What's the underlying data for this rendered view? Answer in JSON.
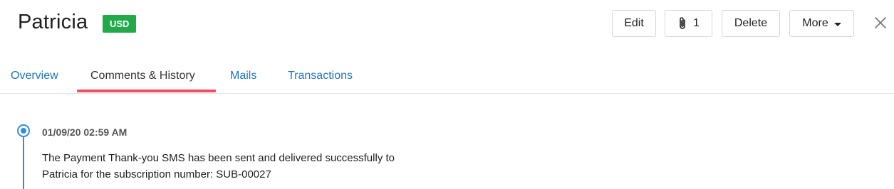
{
  "header": {
    "title": "Patricia",
    "currency_badge": "USD",
    "buttons": {
      "edit": "Edit",
      "attachments_count": "1",
      "delete": "Delete",
      "more": "More"
    },
    "icons": {
      "attachment": "paperclip-icon",
      "more": "caret-down-icon",
      "close": "close-icon"
    }
  },
  "tabs": [
    {
      "label": "Overview",
      "active": false
    },
    {
      "label": "Comments & History",
      "active": true
    },
    {
      "label": "Mails",
      "active": false
    },
    {
      "label": "Transactions",
      "active": false
    }
  ],
  "timeline": [
    {
      "timestamp": "01/09/20 02:59 AM",
      "message_lines": [
        "The Payment Thank-you SMS has been sent and delivered successfully to",
        "Patricia for the subscription number: SUB-00027"
      ]
    }
  ],
  "colors": {
    "badge": "#22a94a",
    "tab_link": "#2175bd",
    "active_indicator": "#f04e61",
    "timeline": "#2f8fdd"
  }
}
